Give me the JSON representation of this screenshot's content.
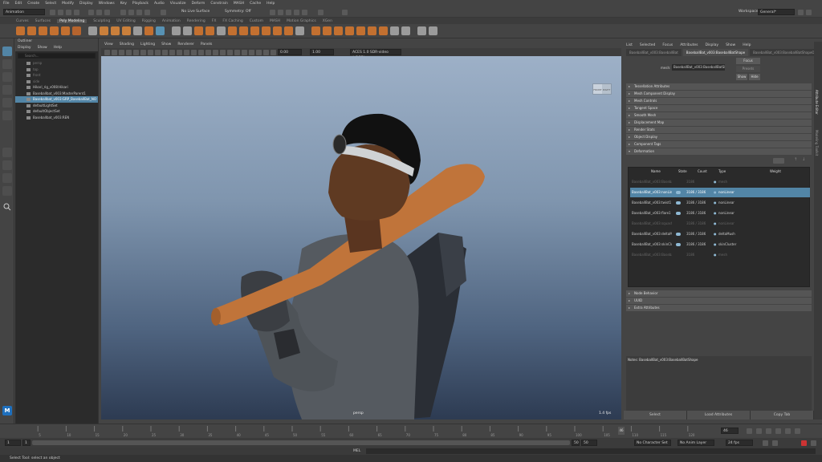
{
  "menubar": [
    "File",
    "Edit",
    "Create",
    "Select",
    "Modify",
    "Display",
    "Windows",
    "Key",
    "Playback",
    "Audio",
    "Visualize",
    "Deform",
    "Constrain",
    "MASH",
    "Cache",
    "Help"
  ],
  "workspace": {
    "label": "Workspace:",
    "value": "General*"
  },
  "status": {
    "mode": "Animation",
    "live_surface": "No Live Surface",
    "symmetry": "Symmetry: Off"
  },
  "shelf_tabs": [
    "Curves",
    "Surfaces",
    "Poly Modeling",
    "Sculpting",
    "UV Editing",
    "Rigging",
    "Animation",
    "Rendering",
    "FX",
    "FX Caching",
    "Custom",
    "MASH",
    "Motion Graphics",
    "XGen"
  ],
  "shelf_active": "Poly Modeling",
  "outliner": {
    "title": "Outliner",
    "menu": [
      "Display",
      "Show",
      "Help"
    ],
    "search": "Search...",
    "rows": [
      {
        "label": "persp",
        "dim": true
      },
      {
        "label": "top",
        "dim": true
      },
      {
        "label": "front",
        "dim": true
      },
      {
        "label": "side",
        "dim": true
      },
      {
        "label": "Hikari_rig_v008:Hikari",
        "dim": false
      },
      {
        "label": "Baseballbat_v003:MasterParent1",
        "dim": false
      },
      {
        "label": "Baseballbat_v003:GRP_BaseballBat_NO",
        "dim": false,
        "sel": true
      },
      {
        "label": "defaultLightSet",
        "dim": false
      },
      {
        "label": "defaultObjectSet",
        "dim": false
      },
      {
        "label": "Baseballbat_v003:REN",
        "dim": false
      }
    ]
  },
  "viewport": {
    "menu": [
      "View",
      "Shading",
      "Lighting",
      "Show",
      "Renderer",
      "Panels"
    ],
    "field1": "0.00",
    "field2": "1.00",
    "colorspace": "ACES 1.0 SDR-video (sRGB)",
    "camera": "persp",
    "fps": "1.4 fps",
    "cube_front": "FRONT",
    "cube_right": "RIGHT"
  },
  "attr": {
    "menu": [
      "List",
      "Selected",
      "Focus",
      "Attributes",
      "Display",
      "Show",
      "Help"
    ],
    "tabs": [
      "BaseballBat_v003:BaseballBat",
      "BaseballBat_v003:BaseballBatShape",
      "BaseballBat_v003:BaseballBatShapeOrig"
    ],
    "active_tab": 1,
    "node_label": "mesh:",
    "node_value": "BaseballBat_v003:BaseballBatShape",
    "focus_btn": "Focus",
    "presets_btn": "Presets",
    "show_btn": "Show",
    "hide_btn": "Hide",
    "sections_top": [
      "Tessellation Attributes",
      "Mesh Component Display",
      "Mesh Controls",
      "Tangent Space",
      "Smooth Mesh",
      "Displacement Map",
      "Render Stats",
      "Object Display",
      "Component Tags"
    ],
    "deformation": "Deformation",
    "table_headers": [
      "Name",
      "State",
      "Count",
      "Type",
      "Weight"
    ],
    "table_rows": [
      {
        "name": "BaseballBat_v003:BaseballBatShapeOrig",
        "state": false,
        "count": "3186",
        "type": "mesh",
        "dim": true
      },
      {
        "name": "BaseballBat_v003:nonLinear1",
        "state": true,
        "count": "3186 / 3186",
        "type": "nonLinear",
        "sel": true
      },
      {
        "name": "BaseballBat_v003:twist1",
        "state": true,
        "count": "3186 / 3186",
        "type": "nonLinear"
      },
      {
        "name": "BaseballBat_v003:flare1",
        "state": true,
        "count": "3186 / 3186",
        "type": "nonLinear"
      },
      {
        "name": "BaseballBat_v003:squash1",
        "state": false,
        "count": "3186 / 3186",
        "type": "nonLinear",
        "dim": true
      },
      {
        "name": "BaseballBat_v003:deltaMush1",
        "state": true,
        "count": "3186 / 3186",
        "type": "deltaMush"
      },
      {
        "name": "BaseballBat_v003:skinCluster1",
        "state": true,
        "count": "3186 / 3186",
        "type": "skinCluster"
      },
      {
        "name": "BaseballBat_v003:BaseballBatShape",
        "state": false,
        "count": "3186",
        "type": "mesh",
        "dim": true
      }
    ],
    "sections_bottom": [
      "Node Behavior",
      "UUID",
      "Extra Attributes"
    ],
    "notes_label": "Notes:  BaseballBat_v003:BaseballBatShape",
    "buttons": [
      "Select",
      "Load Attributes",
      "Copy Tab"
    ]
  },
  "right_tabs": [
    "Attribute Editor",
    "Modeling Toolkit"
  ],
  "timeline": {
    "ticks": [
      "5",
      "10",
      "15",
      "20",
      "25",
      "30",
      "35",
      "40",
      "45",
      "50",
      "55",
      "60",
      "65",
      "70",
      "75",
      "80",
      "85",
      "90",
      "95",
      "100",
      "105",
      "110",
      "115",
      "120"
    ],
    "current": "46",
    "frame": "46"
  },
  "range": {
    "start": "1",
    "start2": "1",
    "end": "50",
    "end2": "50",
    "character": "No Character Set",
    "anim_layer": "No Anim Layer",
    "fps": "24 fps"
  },
  "cmd": {
    "label": "MEL"
  },
  "help_text": "Select Tool: select an object",
  "colors": {
    "accent": "#5285a6",
    "bat": "#c0743a",
    "viewport_top": "#9db0c7"
  }
}
